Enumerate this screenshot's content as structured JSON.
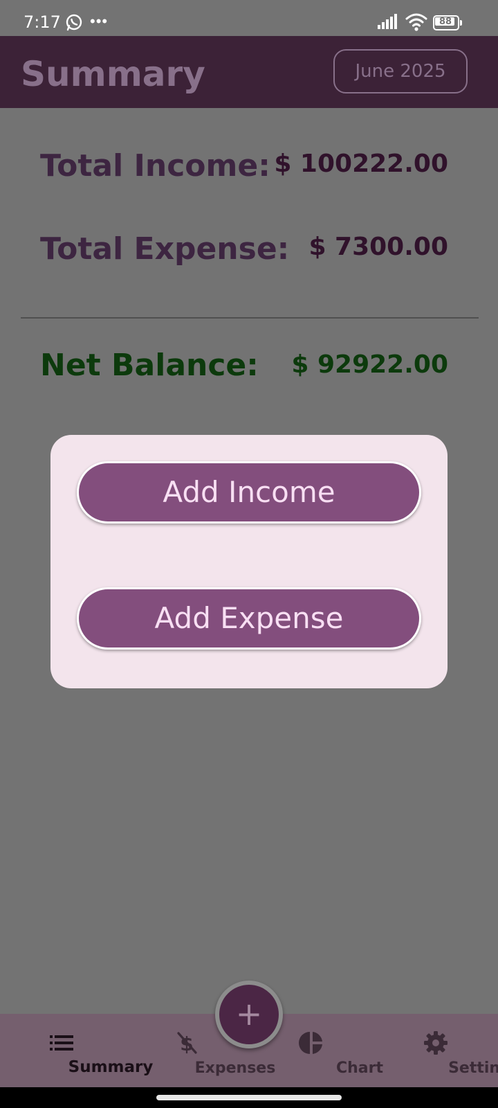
{
  "status_bar": {
    "time": "7:17",
    "battery_level": "88",
    "icons": [
      "whatsapp-icon",
      "more-dots-icon",
      "signal-icon",
      "wifi-icon",
      "battery-icon"
    ]
  },
  "app_bar": {
    "title": "Summary",
    "month": "June 2025"
  },
  "summary": {
    "income_label": "Total Income:",
    "income_value": "$ 100222.00",
    "expense_label": "Total Expense:",
    "expense_value": "$ 7300.00",
    "net_label": "Net Balance:",
    "net_value": "$ 92922.00"
  },
  "dialog": {
    "add_income": "Add Income",
    "add_expense": "Add Expense"
  },
  "fab": {
    "icon": "plus-icon",
    "symbol": "+"
  },
  "bottom_nav": {
    "items": [
      {
        "label": "Summary",
        "icon": "list-icon",
        "active": true
      },
      {
        "label": "Expenses",
        "icon": "money-off-icon",
        "active": false
      },
      {
        "label": "Chart",
        "icon": "pie-chart-icon",
        "active": false
      },
      {
        "label": "Settings",
        "icon": "gear-icon",
        "active": false
      }
    ]
  },
  "colors": {
    "app_bar": "#3c2237",
    "accent": "#834e7d",
    "net_positive": "#0c3a0c",
    "scrim": "#737373",
    "dialog_bg": "#f3e4ec"
  }
}
